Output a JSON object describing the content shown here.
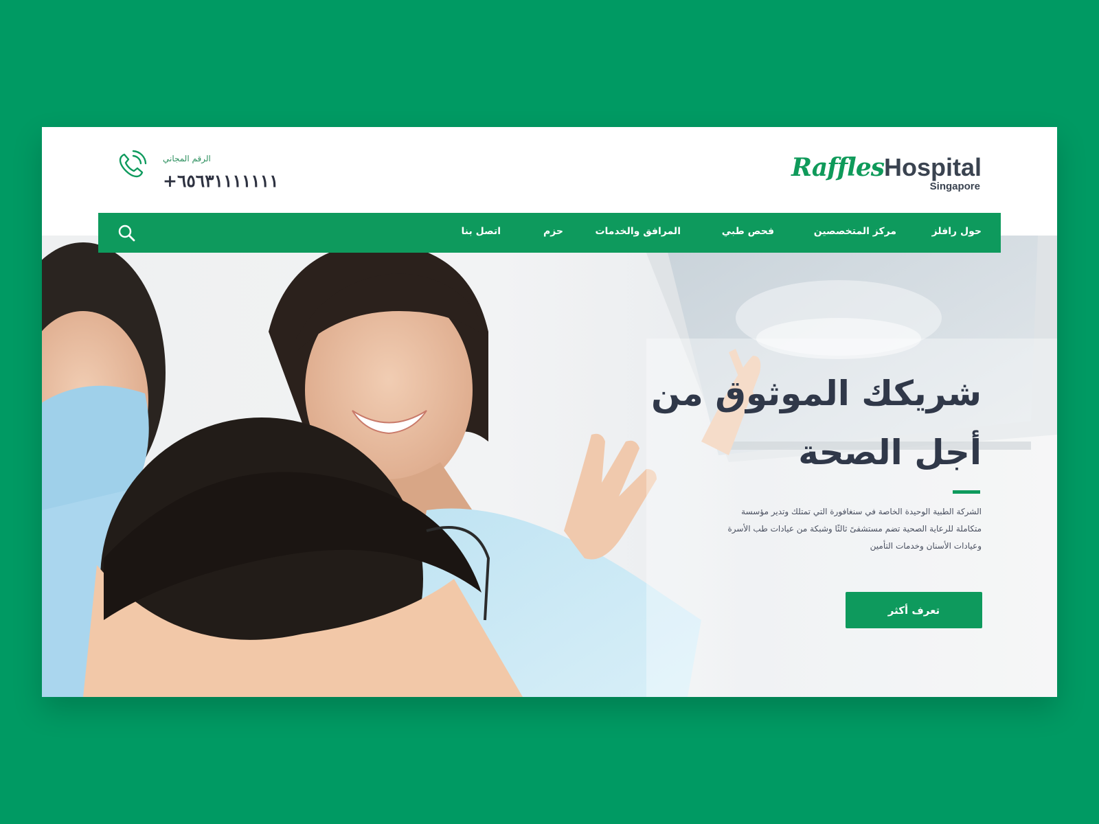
{
  "header": {
    "phone_label": "الرقم المجاني",
    "phone_number": "+٦٥٦٣١١١١١١١",
    "logo_main_part1": "Raffles",
    "logo_main_part2": "Hospital",
    "logo_sub": "Singapore"
  },
  "nav": {
    "items": [
      "حول رافلز",
      "مركز المتخصصين",
      "فحص طبي",
      "المرافق والخدمات",
      "حزم",
      "اتصل بنا"
    ]
  },
  "hero": {
    "headline_line1": "شريكك الموثوق من",
    "headline_line2": "أجل الصحة",
    "desc_line1": "الشركة الطبية الوحيدة الخاصة في سنغافورة التي تمتلك وتدير مؤسسة",
    "desc_line2": "متكاملة للرعاية الصحية تضم مستشفىً ثالثًا وشبكة من عيادات طب الأسرة",
    "desc_line3": "وعيادات الأسنان وخدمات التأمين",
    "cta_label": "تعرف أكثر"
  },
  "colors": {
    "brand_green": "#0e9a5d",
    "page_background": "#009a63",
    "text_dark": "#303849"
  },
  "icons": [
    "phone-icon",
    "search-icon"
  ]
}
